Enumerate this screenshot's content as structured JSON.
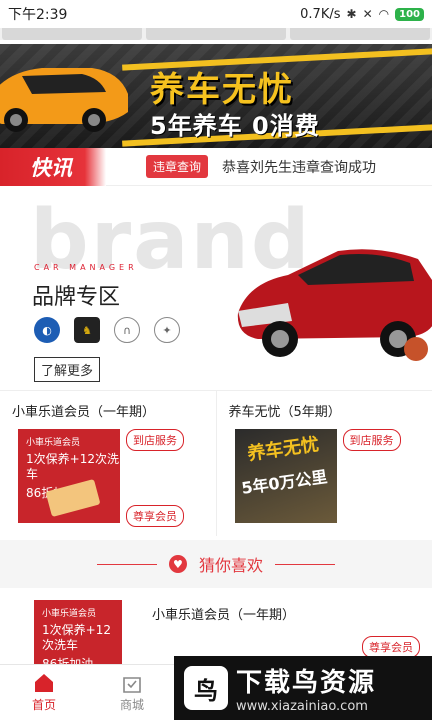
{
  "status_bar": {
    "time": "下午2:39",
    "speed": "0.7K/s",
    "battery": "100"
  },
  "banner": {
    "title": "养车无忧",
    "subtitle": "5年养车 0消费"
  },
  "news": {
    "logo": "快讯",
    "tag": "违章查询",
    "message": "恭喜刘先生违章查询成功"
  },
  "brand": {
    "watermark": "brand",
    "sub": "CAR MANAGER",
    "title": "品牌专区",
    "more": "了解更多",
    "logos": [
      "BMW",
      "Lamborghini",
      "Infiniti",
      "Mercedes"
    ]
  },
  "products": [
    {
      "title": "小車乐道会员（一年期）",
      "badge_top": "到店服务",
      "badge_bottom": "尊享会员",
      "thumb_l1": "小車乐道会员",
      "thumb_l2": "1次保养+12次洗车",
      "thumb_l3": "86折加油"
    },
    {
      "title": "养车无忧（5年期）",
      "badge_top": "到店服务",
      "thumb_t": "养车无忧",
      "thumb_t2": "5年0万公里"
    }
  ],
  "guess": {
    "label": "猜你喜欢"
  },
  "list_item": {
    "title": "小車乐道会员（一年期）",
    "badge": "尊享会员",
    "thumb_l1": "小車乐道会员",
    "thumb_l2": "1次保养+12次洗车",
    "thumb_l3": "86折加油"
  },
  "tabbar": {
    "home": "首页",
    "mall": "商城"
  },
  "site_watermark": {
    "title": "下载鸟资源",
    "url": "www.xiazainiao.com"
  },
  "colors": {
    "accent": "#d8232a",
    "banner_yellow": "#f3c020"
  }
}
